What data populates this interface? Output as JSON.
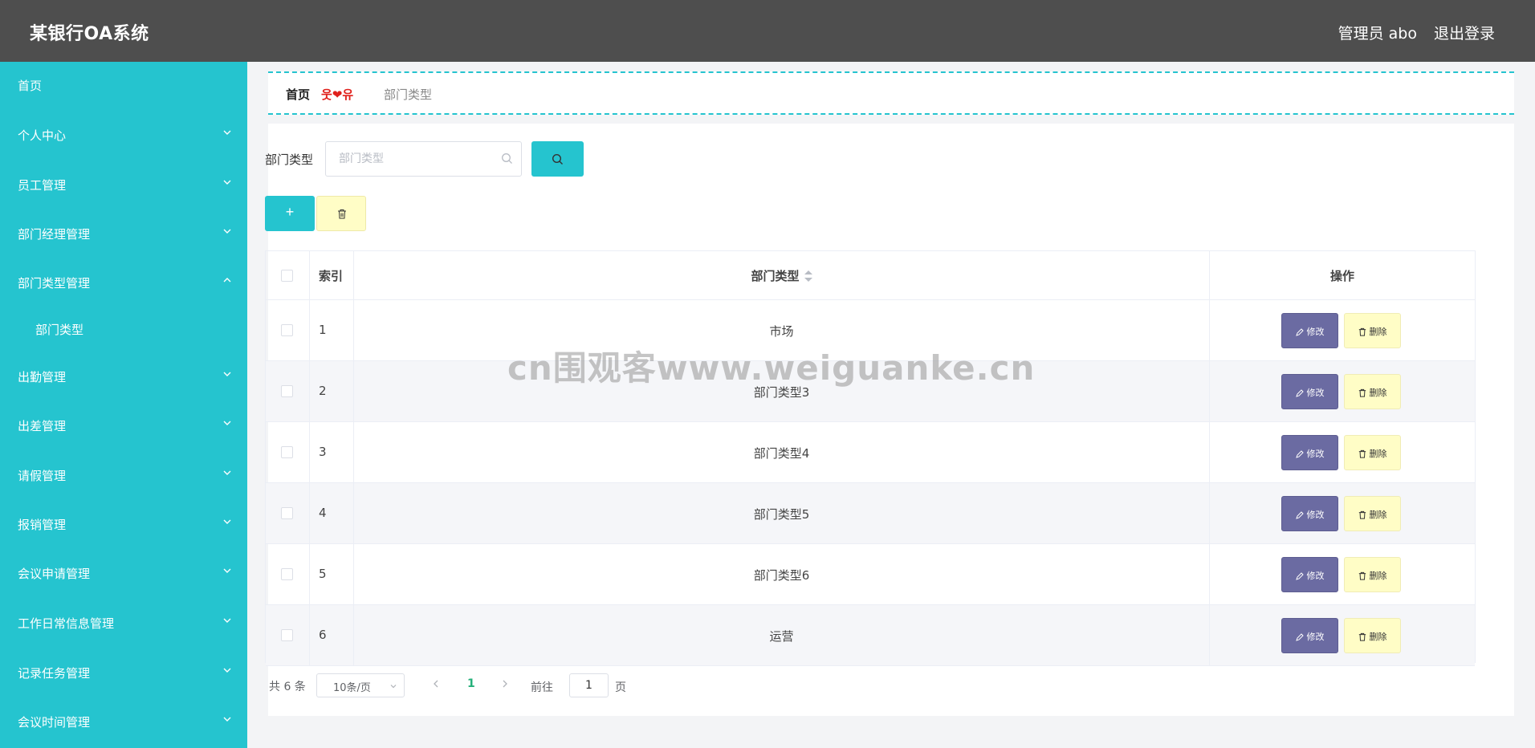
{
  "header": {
    "app_title": "某银行OA系统",
    "admin_label": "管理员 abo",
    "logout_label": "退出登录"
  },
  "sidebar": {
    "items": [
      {
        "label": "首页"
      },
      {
        "label": "个人中心"
      },
      {
        "label": "员工管理"
      },
      {
        "label": "部门经理管理"
      },
      {
        "label": "部门类型管理"
      },
      {
        "label": "部门类型"
      },
      {
        "label": "出勤管理"
      },
      {
        "label": "出差管理"
      },
      {
        "label": "请假管理"
      },
      {
        "label": "报销管理"
      },
      {
        "label": "会议申请管理"
      },
      {
        "label": "工作日常信息管理"
      },
      {
        "label": "记录任务管理"
      },
      {
        "label": "会议时间管理"
      }
    ]
  },
  "breadcrumb": {
    "home": "首页",
    "separator": "웃❤유",
    "current": "部门类型"
  },
  "search": {
    "label": "部门类型",
    "placeholder": "部门类型",
    "value": ""
  },
  "table": {
    "headers": {
      "index": "索引",
      "type": "部门类型",
      "actions": "操作"
    },
    "edit_label": "修改",
    "delete_label": "删除",
    "rows": [
      {
        "index": "1",
        "type": "市场"
      },
      {
        "index": "2",
        "type": "部门类型3"
      },
      {
        "index": "3",
        "type": "部门类型4"
      },
      {
        "index": "4",
        "type": "部门类型5"
      },
      {
        "index": "5",
        "type": "部门类型6"
      },
      {
        "index": "6",
        "type": "运营"
      }
    ]
  },
  "pagination": {
    "total": "共 6 条",
    "page_size": "10条/页",
    "current_page": "1",
    "goto_label": "前往",
    "goto_value": "1",
    "page_unit": "页"
  },
  "watermark": "cn围观客www.weiguanke.cn",
  "colors": {
    "header_bg": "#4e4e4e",
    "sidebar_bg": "#25c4cf",
    "accent": "#25c4cf",
    "edit_button": "#6b6ba2",
    "delete_button": "#fffdc6"
  }
}
